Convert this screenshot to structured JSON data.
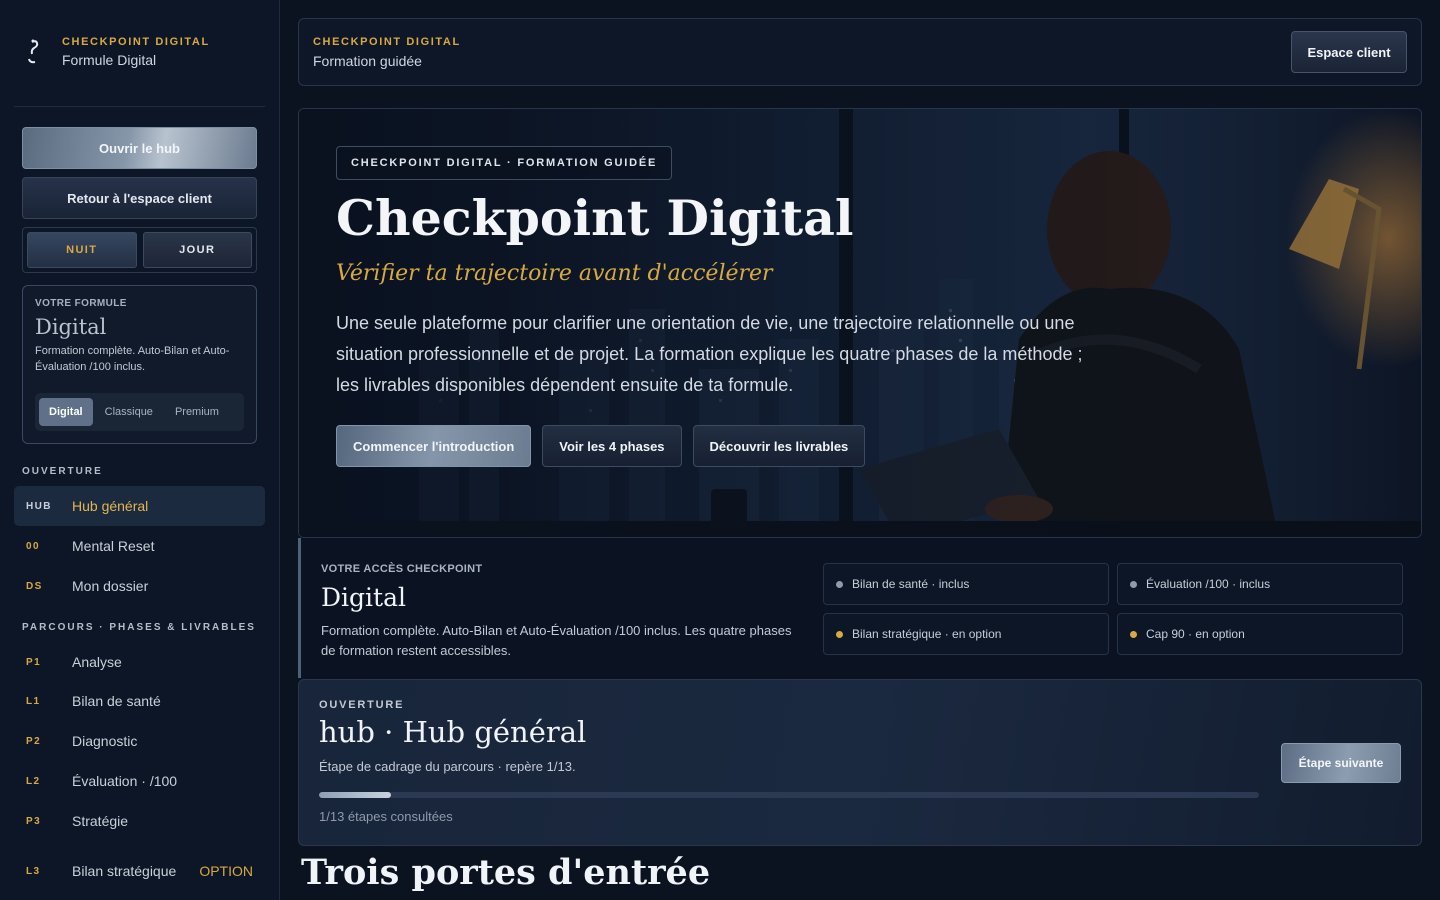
{
  "brand": {
    "name": "CHECKPOINT DIGITAL",
    "plan": "Formule Digital",
    "icon": "question-hook-icon"
  },
  "sidebar": {
    "open_hub": "Ouvrir le hub",
    "back_client": "Retour à l'espace client",
    "mode": {
      "night": "NUIT",
      "day": "JOUR",
      "selected": "NUIT"
    },
    "formula": {
      "label": "VOTRE FORMULE",
      "title": "Digital",
      "description": "Formation complète. Auto-Bilan et Auto-Évaluation /100 inclus.",
      "options": [
        "Digital",
        "Classique",
        "Premium"
      ],
      "selected": "Digital"
    },
    "sections": [
      {
        "title": "OUVERTURE",
        "items": [
          {
            "code": "HUB",
            "label": "Hub général",
            "active": true
          },
          {
            "code": "00",
            "label": "Mental Reset"
          },
          {
            "code": "DS",
            "label": "Mon dossier"
          }
        ]
      },
      {
        "title": "PARCOURS · PHASES & LIVRABLES",
        "items": [
          {
            "code": "P1",
            "label": "Analyse"
          },
          {
            "code": "L1",
            "label": "Bilan de santé"
          },
          {
            "code": "P2",
            "label": "Diagnostic"
          },
          {
            "code": "L2",
            "label": "Évaluation · /100"
          },
          {
            "code": "P3",
            "label": "Stratégie"
          },
          {
            "code": "L3",
            "label": "Bilan stratégique",
            "badge": "OPTION"
          }
        ]
      }
    ]
  },
  "topbar": {
    "brand": "CHECKPOINT DIGITAL",
    "subtitle": "Formation guidée",
    "client_button": "Espace client"
  },
  "hero": {
    "tag": "CHECKPOINT DIGITAL · FORMATION GUIDÉE",
    "title": "Checkpoint Digital",
    "subtitle": "Vérifier ta trajectoire avant d'accélérer",
    "description": "Une seule plateforme pour clarifier une orientation de vie, une trajectoire relationnelle ou une situation professionnelle et de projet. La formation explique les quatre phases de la méthode ; les livrables disponibles dépendent ensuite de ta formule.",
    "buttons": [
      "Commencer l'introduction",
      "Voir les 4 phases",
      "Découvrir les livrables"
    ]
  },
  "access": {
    "label": "VOTRE ACCÈS CHECKPOINT",
    "title": "Digital",
    "description": "Formation complète. Auto-Bilan et Auto-Évaluation /100 inclus. Les quatre phases de formation restent accessibles.",
    "chips": [
      {
        "label": "Bilan de santé · inclus",
        "status": "included"
      },
      {
        "label": "Évaluation /100 · inclus",
        "status": "included"
      },
      {
        "label": "Bilan stratégique · en option",
        "status": "option"
      },
      {
        "label": "Cap 90 · en option",
        "status": "option"
      }
    ]
  },
  "progress": {
    "label": "OUVERTURE",
    "title": "hub · Hub général",
    "description": "Étape de cadrage du parcours · repère 1/13.",
    "current": 1,
    "total": 13,
    "count_text": "1/13 étapes consultées",
    "next_button": "Étape suivante"
  },
  "next_section_title": "Trois portes d'entrée",
  "colors": {
    "accent_gold": "#d8a941",
    "background": "#0b1220",
    "included_dot": "#8f9aab",
    "option_dot": "#d8a941"
  }
}
